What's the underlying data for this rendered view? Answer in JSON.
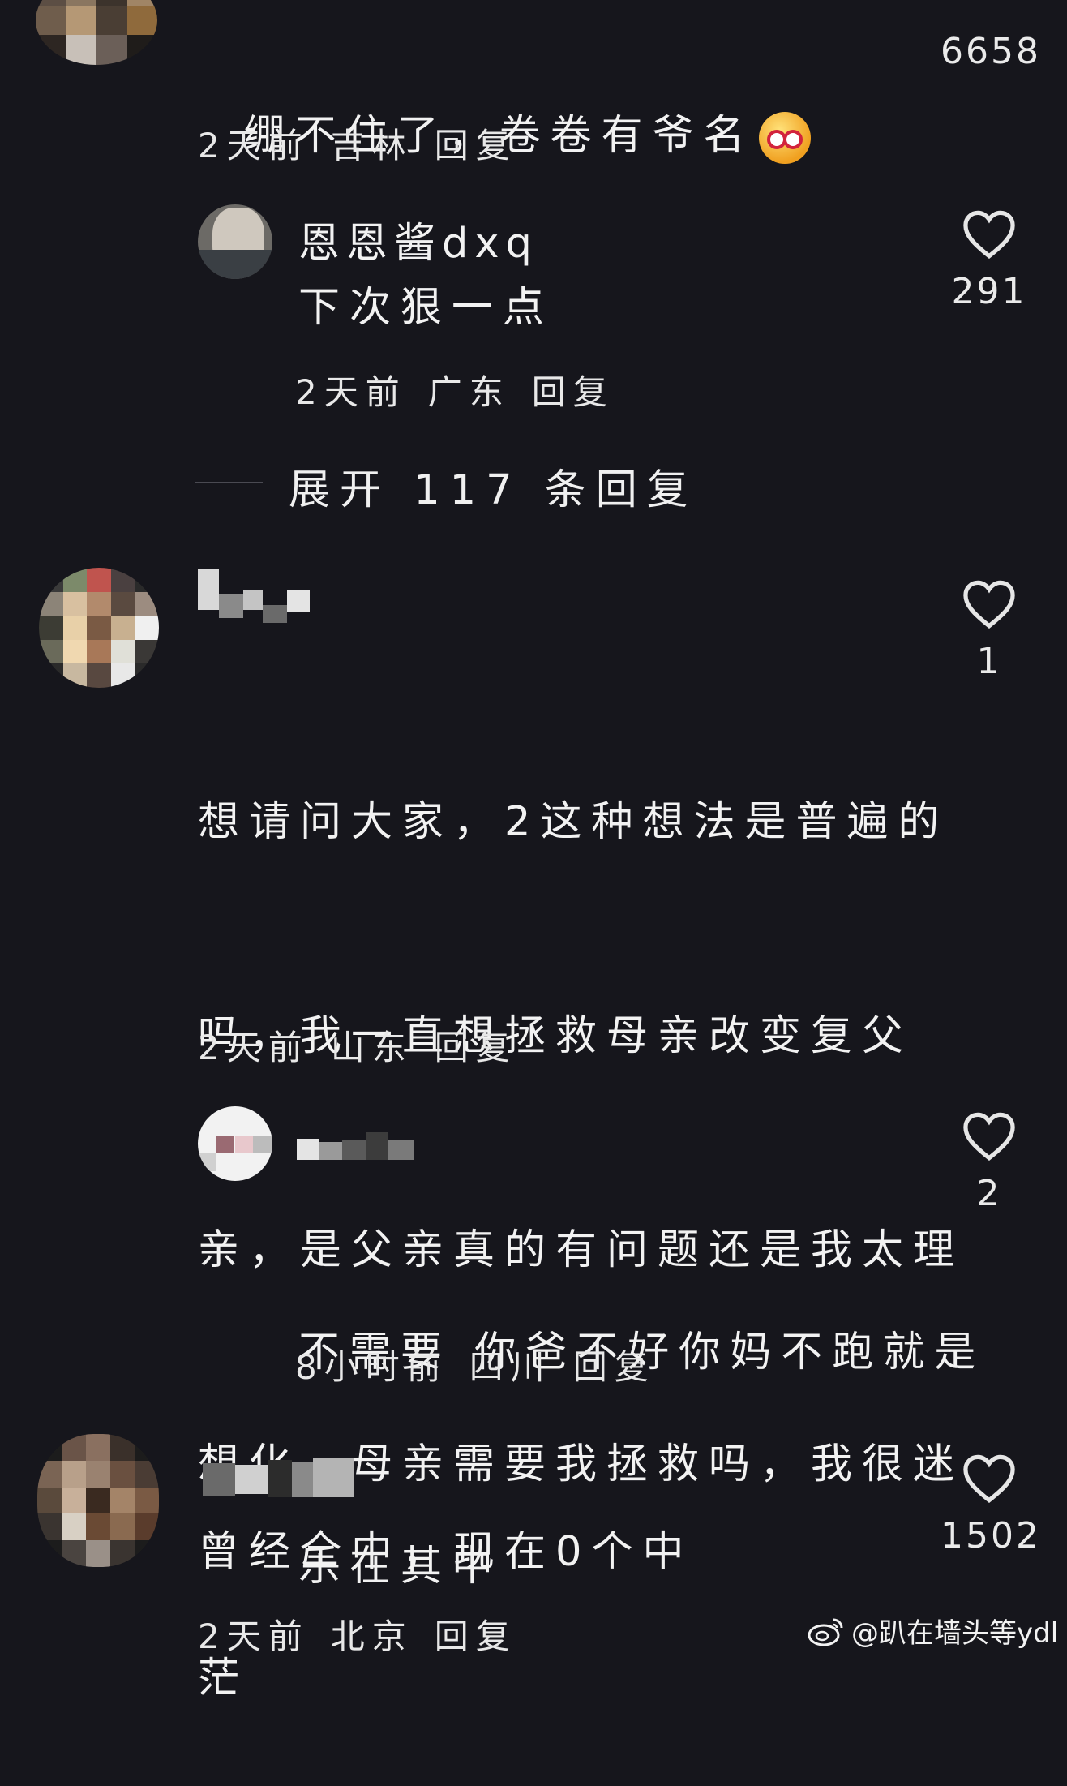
{
  "comments": [
    {
      "text": "绷不住了，卷卷有爷名",
      "emoji": "laughing-face-emoji",
      "time": "2天前",
      "location": "吉林",
      "reply": "回复",
      "likes": "6658",
      "replies": [
        {
          "username": "恩恩酱dxq",
          "text": "下次狠一点",
          "time": "2天前",
          "location": "广东",
          "reply": "回复",
          "likes": "291"
        }
      ],
      "expand": "展开 117 条回复"
    },
    {
      "text": "想请问大家，2这种想法是普遍的吗，我一直想拯救母亲改变复父亲，是父亲真的有问题还是我太理想化，母亲需要我拯救吗，我很迷茫",
      "lines": [
        "想请问大家，2这种想法是普遍的",
        "吗，我一直想拯救母亲改变复父",
        "亲，是父亲真的有问题还是我太理",
        "想化，母亲需要我拯救吗，我很迷",
        "茫"
      ],
      "time": "2天前",
      "location": "山东",
      "reply": "回复",
      "likes": "1",
      "replies": [
        {
          "lines": [
            "不需要 你爸不好你妈不跑就是",
            "乐在其中"
          ],
          "time": "8小时前",
          "location": "四川",
          "reply": "回复",
          "likes": "2"
        }
      ]
    },
    {
      "text": "曾经全中，现在0个中",
      "time": "2天前",
      "location": "北京",
      "reply": "回复",
      "likes": "1502"
    }
  ],
  "watermark": "@趴在墙头等ydl",
  "colors": {
    "background": "#16161c",
    "text": "#f0f0f0",
    "line": "#4a4a52"
  }
}
